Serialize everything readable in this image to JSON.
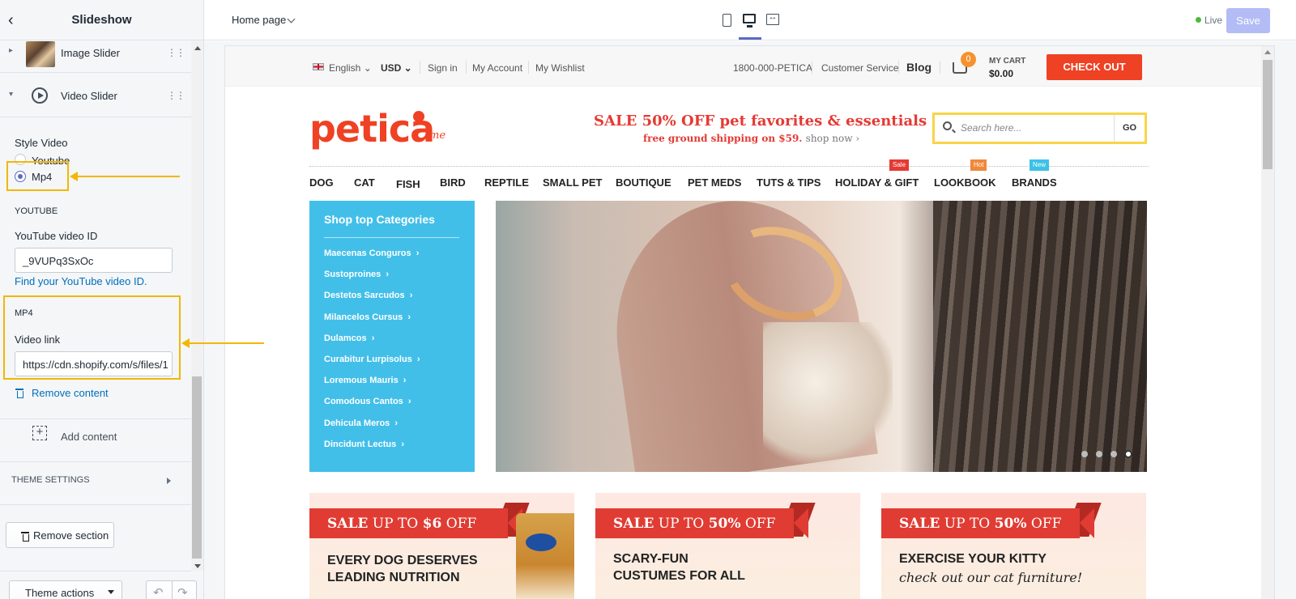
{
  "sidebar": {
    "title": "Slideshow",
    "back_icon": "chevron-left-icon",
    "blocks": [
      {
        "label": "Image Slider",
        "icon": "image-thumbnail"
      },
      {
        "label": "Video Slider",
        "icon": "play-circle-icon"
      }
    ],
    "style_video": {
      "label": "Style Video",
      "options": [
        "Youtube",
        "Mp4"
      ],
      "selected": "Mp4"
    },
    "youtube": {
      "heading": "YOUTUBE",
      "id_label": "YouTube video ID",
      "id_value": "_9VUPq3SxOc",
      "help_link": "Find your YouTube video ID."
    },
    "mp4": {
      "heading": "MP4",
      "link_label": "Video link",
      "link_value": "https://cdn.shopify.com/s/files/1"
    },
    "remove_content": "Remove content",
    "add_content": "Add content",
    "theme_settings": "THEME SETTINGS",
    "remove_section": "Remove section",
    "theme_actions": "Theme actions"
  },
  "topbar": {
    "page_select": "Home page",
    "live_label": "Live",
    "save_label": "Save",
    "colors": {
      "accent": "#5c6ac4",
      "save_disabled": "#b3bcf5",
      "live": "#50b83c",
      "highlight": "#f2b705"
    }
  },
  "store": {
    "language": "English",
    "currency": "USD",
    "sign_in": "Sign in",
    "my_account": "My Account",
    "my_wishlist": "My Wishlist",
    "phone": "1800-000-PETICA",
    "customer_service": "Customer Service",
    "blog": "Blog",
    "cart_count": "0",
    "my_cart": "MY CART",
    "cart_total": "$0.00",
    "checkout": "CHECK OUT",
    "logo": "petica",
    "logo_suffix": "me",
    "sale_headline": "SALE 50% OFF pet favorites & essentials",
    "sale_sub": "free ground shipping on $59.",
    "shop_now": "shop now ›",
    "search_placeholder": "Search here...",
    "search_go": "GO",
    "nav": [
      {
        "label": "DOG"
      },
      {
        "label": "CAT"
      },
      {
        "label": "FISH"
      },
      {
        "label": "BIRD"
      },
      {
        "label": "REPTILE"
      },
      {
        "label": "SMALL PET"
      },
      {
        "label": "BOUTIQUE"
      },
      {
        "label": "PET MEDS"
      },
      {
        "label": "TUTS & TIPS"
      },
      {
        "label": "HOLIDAY & GIFT",
        "badge": "Sale",
        "badge_color": "#e53a34"
      },
      {
        "label": "LOOKBOOK",
        "badge": "Hot",
        "badge_color": "#f0883a"
      },
      {
        "label": "BRANDS",
        "badge": "New",
        "badge_color": "#3cc1e8"
      }
    ],
    "categories_title": "Shop top Categories",
    "categories": [
      "Maecenas Conguros",
      "Sustoproines",
      "Destetos Sarcudos",
      "Milancelos Cursus",
      "Dulamcos",
      "Curabitur Lurpisolus",
      "Loremous Mauris",
      "Comodous Cantos",
      "Dehicula Meros",
      "Dincidunt Lectus"
    ],
    "slider_dots": 4,
    "slider_active_dot": 4,
    "promos": [
      {
        "ribbon_pre": "SALE",
        "ribbon_mid": " UP TO ",
        "ribbon_val": "$6",
        "ribbon_post": " OFF",
        "line1": "EVERY DOG DESERVES",
        "line2": "LEADING NUTRITION"
      },
      {
        "ribbon_pre": "SALE",
        "ribbon_mid": " UP TO ",
        "ribbon_val": "50%",
        "ribbon_post": " OFF",
        "line1": "SCARY-FUN",
        "line2": "CUSTUMES FOR ALL"
      },
      {
        "ribbon_pre": "SALE",
        "ribbon_mid": " UP TO ",
        "ribbon_val": "50%",
        "ribbon_post": " OFF",
        "line1": "EXERCISE YOUR KITTY",
        "line2": "check out our cat furniture!"
      }
    ],
    "colors": {
      "brand_red": "#ef4123",
      "category_blue": "#42bfe9",
      "search_border": "#f8d548",
      "cart_badge": "#f5922f"
    }
  }
}
